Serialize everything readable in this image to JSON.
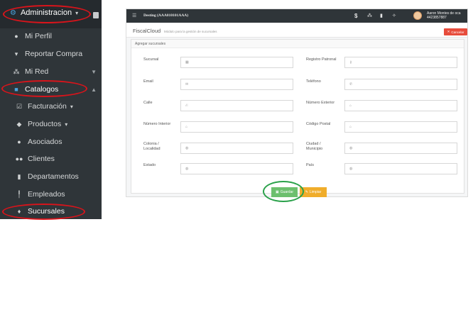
{
  "sidebar": {
    "header": {
      "label": "Administracion",
      "icon": "gears-icon"
    },
    "items": [
      {
        "label": "Mi Perfil",
        "icon": "user-icon"
      },
      {
        "label": "Reportar Compra",
        "icon": "cart-icon"
      },
      {
        "label": "Mi Red",
        "icon": "sitemap-icon"
      },
      {
        "label": "Catalogos",
        "icon": "book-icon"
      },
      {
        "label": "Facturación",
        "icon": "check-square-icon"
      },
      {
        "label": "Productos",
        "icon": "tags-icon"
      },
      {
        "label": "Asociados",
        "icon": "user-icon"
      },
      {
        "label": "Clientes",
        "icon": "users-icon"
      },
      {
        "label": "Departamentos",
        "icon": "building-icon"
      },
      {
        "label": "Empleados",
        "icon": "male-icon"
      },
      {
        "label": "Sucursales",
        "icon": "map-marker-icon"
      }
    ]
  },
  "topbar": {
    "brand": "Desting (AAA010101AAA)",
    "icons": [
      "dollar-icon",
      "sitemap-icon",
      "book-icon",
      "wrench-icon"
    ],
    "user_name": "Aaron Montes de oca",
    "user_phone": "4423857887"
  },
  "page": {
    "title": "FiscalCloud",
    "description": "Módulo para la gestión de sucursales",
    "cancel_label": "Cancelar"
  },
  "form": {
    "section_title": "Agregar sucursales",
    "fields": [
      {
        "label": "Sucursal",
        "icon": "building-icon"
      },
      {
        "label": "Registro Patronal",
        "icon": "key-icon"
      },
      {
        "label": "Email",
        "icon": "envelope-icon"
      },
      {
        "label": "Teléfono",
        "icon": "phone-icon"
      },
      {
        "label": "Calle",
        "icon": "road-icon"
      },
      {
        "label": "Número Exterior",
        "icon": "home-icon"
      },
      {
        "label": "Número Interior",
        "icon": "home-icon"
      },
      {
        "label": "Código Postal",
        "icon": "home-icon"
      },
      {
        "label": "Colonia / Localidad",
        "icon": "globe-icon"
      },
      {
        "label": "Ciudad / Municipio",
        "icon": "globe-icon"
      },
      {
        "label": "Estado",
        "icon": "globe-icon"
      },
      {
        "label": "País",
        "icon": "globe-icon"
      }
    ],
    "save_label": "Guardar",
    "clear_label": "Limpiar"
  },
  "colors": {
    "sidebar_bg": "#2f3539",
    "highlight": "#d9141b",
    "save": "#6cbf6e",
    "clear": "#f0ad2b",
    "cancel": "#e74c3c",
    "focus_ring": "#2aa14a"
  }
}
